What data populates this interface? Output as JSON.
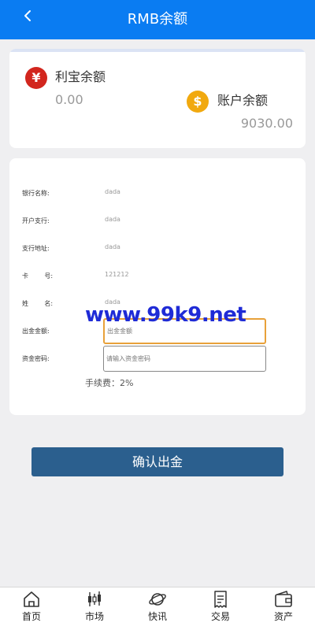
{
  "header": {
    "title": "RMB余额",
    "back_icon": "chevron-left-icon"
  },
  "balances": {
    "libao": {
      "label": "利宝余额",
      "value": "0.00",
      "icon": "yen-coin-icon",
      "icon_glyph": "¥",
      "color": "#d2261e"
    },
    "account": {
      "label": "账户余额",
      "value": "9030.00",
      "icon": "dollar-coin-icon",
      "icon_glyph": "$",
      "color": "#f1a90f"
    }
  },
  "form": {
    "bank_name": {
      "label": "银行名称:",
      "value": "dada"
    },
    "branch": {
      "label": "开户支行:",
      "value": "dada"
    },
    "branch_address": {
      "label": "支行地址:",
      "value": "dada"
    },
    "card_number": {
      "label": "卡        号:",
      "value": "121212"
    },
    "name": {
      "label": "姓        名:",
      "value": "dada"
    },
    "amount": {
      "label": "出金金额:",
      "placeholder": "出金金额"
    },
    "password": {
      "label": "资金密码:",
      "placeholder": "请输入资金密码"
    },
    "fee": "手续费：2%"
  },
  "watermark": "www.99k9.net",
  "confirm_label": "确认出金",
  "tabbar": [
    {
      "label": "首页",
      "icon": "home-icon"
    },
    {
      "label": "市场",
      "icon": "candlestick-icon"
    },
    {
      "label": "快讯",
      "icon": "planet-icon"
    },
    {
      "label": "交易",
      "icon": "receipt-icon"
    },
    {
      "label": "资产",
      "icon": "wallet-icon"
    }
  ],
  "colors": {
    "header": "#0a7cf2",
    "confirm_button": "#2b5f8e",
    "focus_border": "#e8a13a",
    "watermark": "#1f2bd6"
  }
}
